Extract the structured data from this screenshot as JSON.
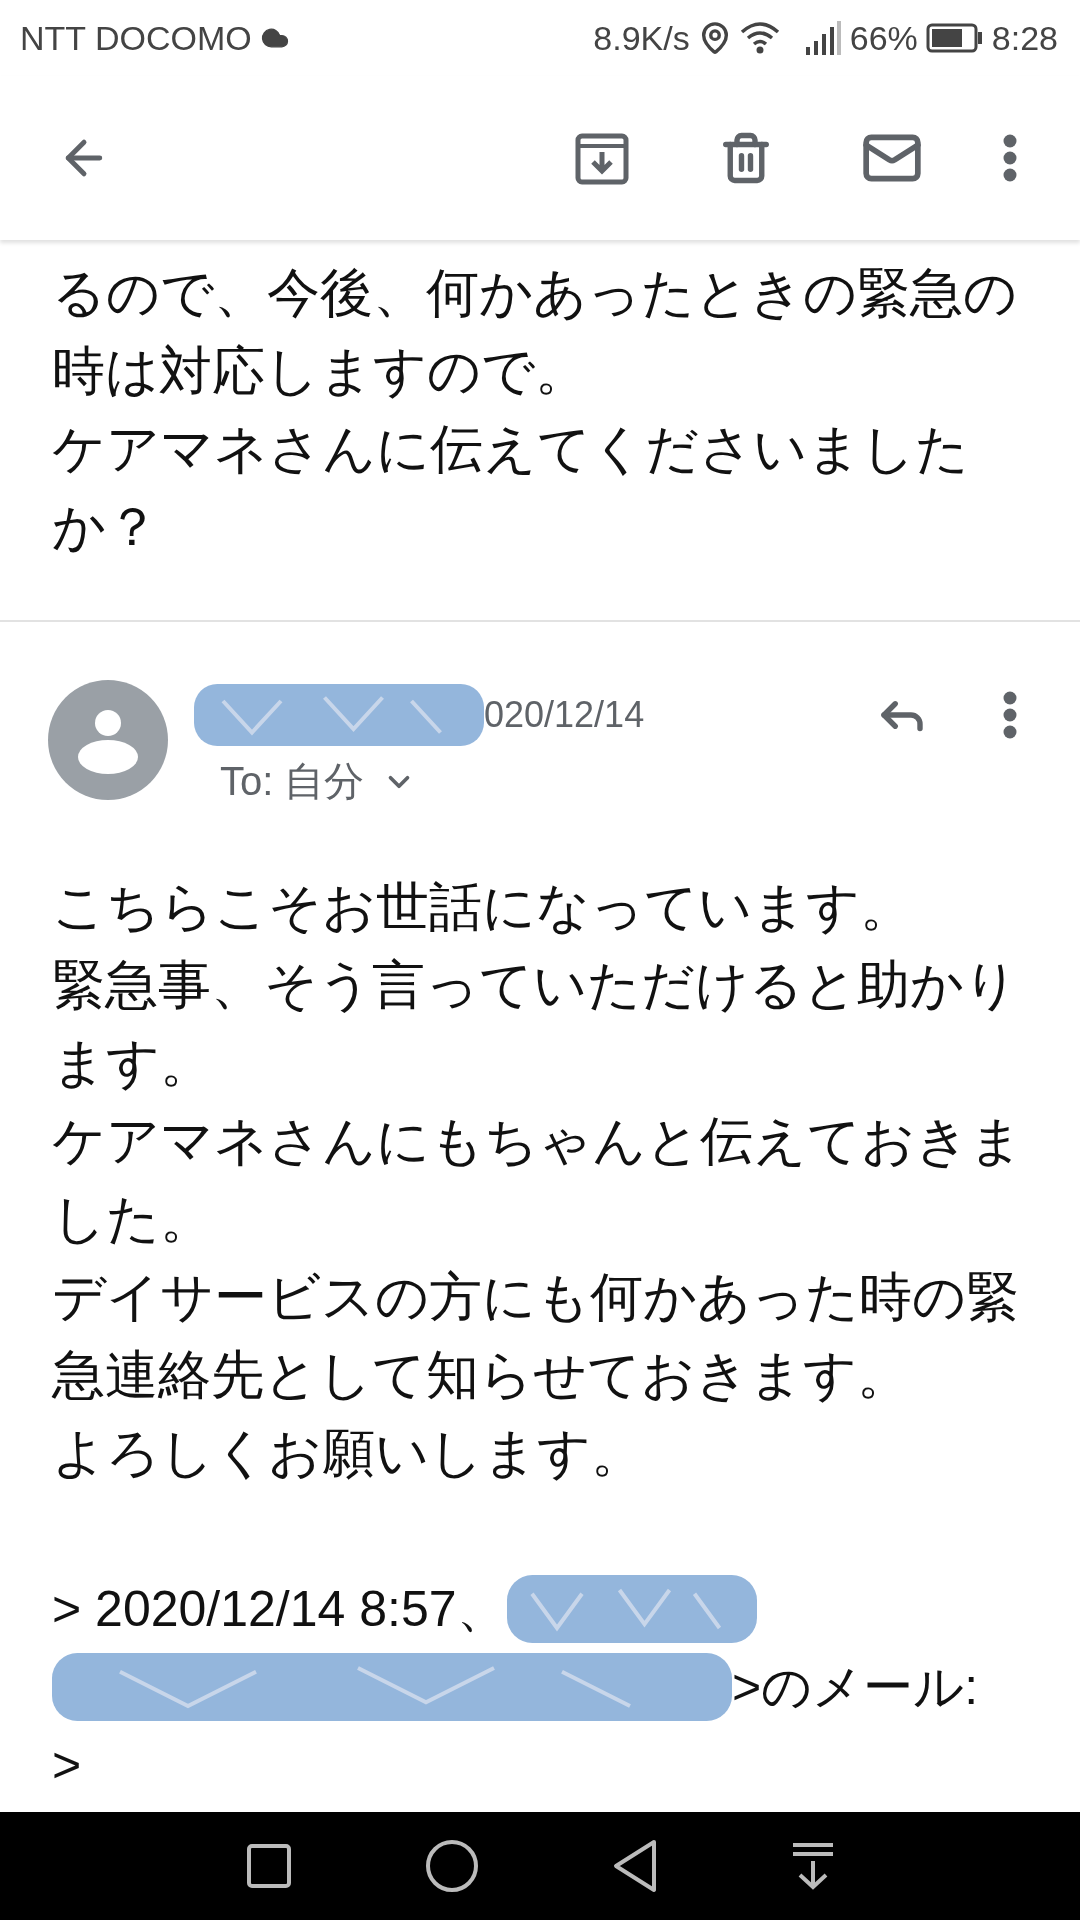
{
  "status_bar": {
    "carrier": "NTT DOCOMO",
    "speed": "8.9K/s",
    "battery": "66%",
    "time": "8:28"
  },
  "previous_message": {
    "body": [
      "るので、今後、何かあったときの緊急の時は対応しますので。",
      "ケアマネさんに伝えてくださいましたか？"
    ]
  },
  "message": {
    "date": "020/12/14",
    "recipient": "To: 自分",
    "body": [
      "こちらこそお世話になっています。",
      "緊急事、そう言っていただけると助かります。",
      "ケアマネさんにもちゃんと伝えておきました。",
      "デイサービスの方にも何かあった時の緊急連絡先として知らせておきます。",
      "よろしくお願いします。"
    ],
    "quote": [
      {
        "kind": "text_then_redaction",
        "text": "> 2020/12/14 8:57、"
      },
      {
        "kind": "redaction_then_text",
        "text": ">のメール:"
      },
      {
        "kind": "text",
        "text": ">"
      }
    ]
  }
}
